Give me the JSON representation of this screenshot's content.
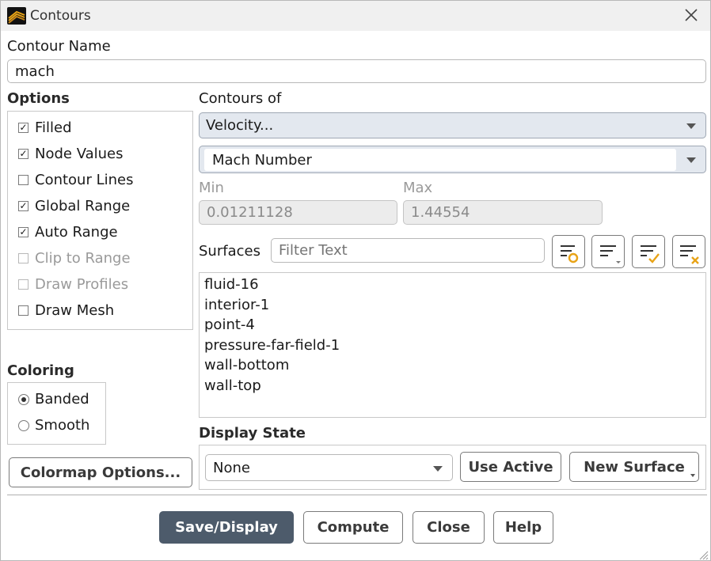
{
  "window": {
    "title": "Contours",
    "app_icon": "ansys-fluent-icon",
    "close_icon": "close-icon"
  },
  "contour_name": {
    "label": "Contour Name",
    "value": "mach"
  },
  "options": {
    "label": "Options",
    "items": [
      {
        "label": "Filled",
        "checked": true,
        "enabled": true
      },
      {
        "label": "Node Values",
        "checked": true,
        "enabled": true
      },
      {
        "label": "Contour Lines",
        "checked": false,
        "enabled": true
      },
      {
        "label": "Global Range",
        "checked": true,
        "enabled": true
      },
      {
        "label": "Auto Range",
        "checked": true,
        "enabled": true
      },
      {
        "label": "Clip to Range",
        "checked": false,
        "enabled": false
      },
      {
        "label": "Draw Profiles",
        "checked": false,
        "enabled": false
      },
      {
        "label": "Draw Mesh",
        "checked": false,
        "enabled": true
      }
    ]
  },
  "coloring": {
    "label": "Coloring",
    "items": [
      {
        "label": "Banded",
        "selected": true
      },
      {
        "label": "Smooth",
        "selected": false
      }
    ]
  },
  "colormap_button": "Colormap Options...",
  "contours_of": {
    "label": "Contours of",
    "category": "Velocity...",
    "quantity": "Mach Number"
  },
  "range": {
    "min_label": "Min",
    "min_value": "0.01211128",
    "max_label": "Max",
    "max_value": "1.44554"
  },
  "surfaces": {
    "label": "Surfaces",
    "filter_placeholder": "Filter Text",
    "toolbar_icons": [
      "select-new-surface-icon",
      "select-all-icon",
      "select-highlighted-icon",
      "deselect-all-icon"
    ],
    "items": [
      "fluid-16",
      "interior-1",
      "point-4",
      "pressure-far-field-1",
      "wall-bottom",
      "wall-top"
    ]
  },
  "display_state": {
    "label": "Display State",
    "value": "None",
    "use_active": "Use Active",
    "new_surface": "New Surface"
  },
  "footer": {
    "save_display": "Save/Display",
    "compute": "Compute",
    "close": "Close",
    "help": "Help"
  },
  "colors": {
    "primary_button": "#4d5b6b",
    "dropdown_bg": "#e3e8ef",
    "accent_orange": "#e8a317"
  }
}
